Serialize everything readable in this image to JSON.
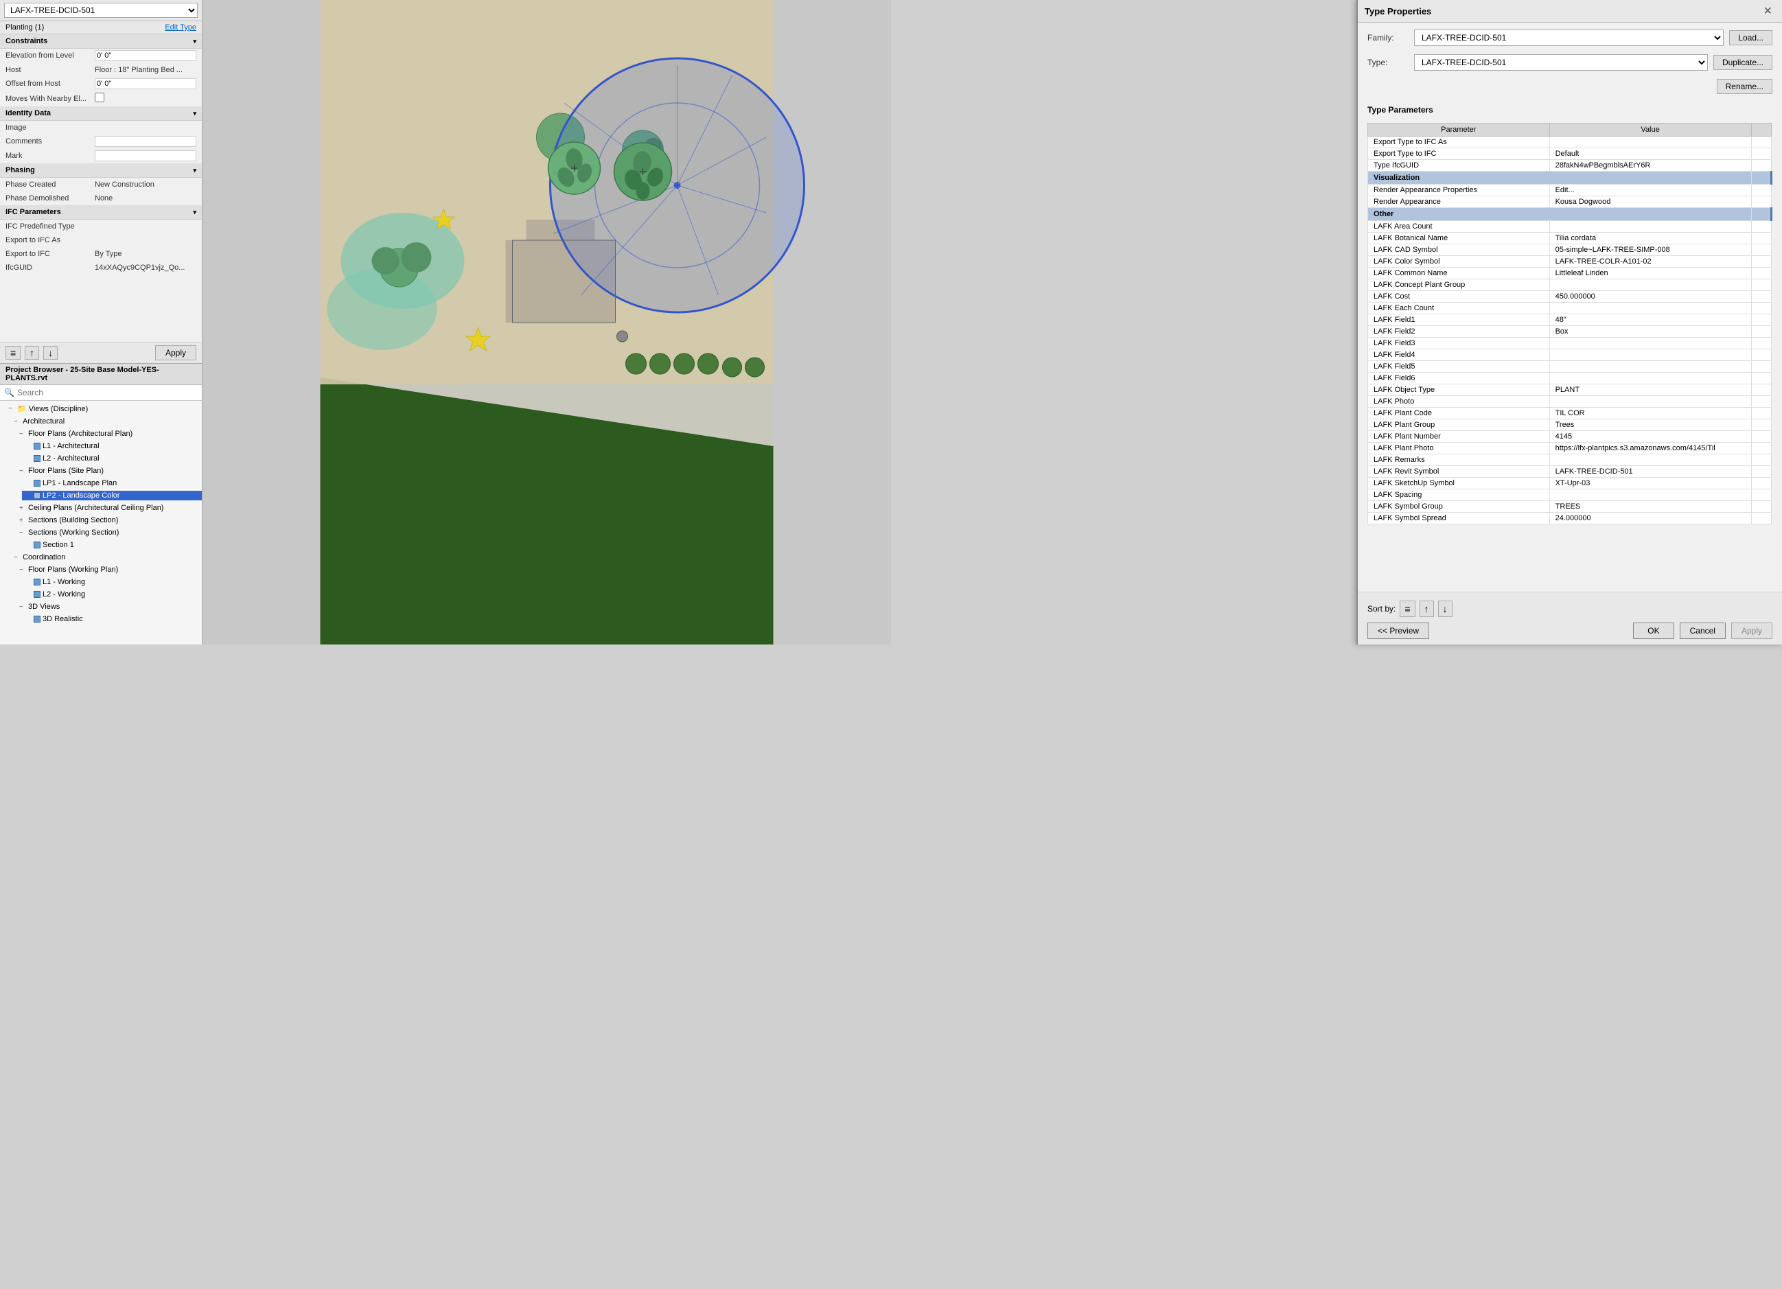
{
  "leftPanel": {
    "familyDropdown": {
      "value": "LAFXTREE-DCID-501",
      "options": [
        "LAFXTREE-DCID-501"
      ]
    },
    "editTypeLabel": "Edit Type",
    "instanceLabel": "Planting (1)",
    "sections": [
      {
        "name": "Constraints",
        "properties": [
          {
            "label": "Elevation from Level",
            "value": "0' 0\"",
            "editable": true
          },
          {
            "label": "Host",
            "value": "Floor : 18\" Planting Bed ...",
            "editable": false
          },
          {
            "label": "Offset from Host",
            "value": "0' 0\"",
            "editable": true
          },
          {
            "label": "Moves With Nearby El...",
            "value": "",
            "isCheckbox": true
          }
        ]
      },
      {
        "name": "Identity Data",
        "properties": [
          {
            "label": "Image",
            "value": "",
            "editable": false
          },
          {
            "label": "Comments",
            "value": "",
            "editable": true
          },
          {
            "label": "Mark",
            "value": "",
            "editable": true
          }
        ]
      },
      {
        "name": "Phasing",
        "properties": [
          {
            "label": "Phase Created",
            "value": "New Construction",
            "editable": false
          },
          {
            "label": "Phase Demolished",
            "value": "None",
            "editable": false
          }
        ]
      },
      {
        "name": "IFC Parameters",
        "properties": [
          {
            "label": "IFC Predefined Type",
            "value": "",
            "editable": false
          },
          {
            "label": "Export to IFC As",
            "value": "",
            "editable": false
          },
          {
            "label": "Export to IFC",
            "value": "By Type",
            "editable": false
          },
          {
            "label": "IfcGUID",
            "value": "14xXAQyc9CQP1vjz_Qo...",
            "editable": false
          }
        ]
      }
    ],
    "toolbar": {
      "icons": [
        "sort-alpha",
        "sort-category",
        "sort-custom"
      ],
      "applyLabel": "Apply"
    }
  },
  "projectBrowser": {
    "title": "Project Browser - 25-Site Base Model-YES-PLANTS.rvt",
    "searchPlaceholder": "Search",
    "tree": [
      {
        "label": "Views (Discipline)",
        "level": 0,
        "expanded": true,
        "type": "group"
      },
      {
        "label": "Architectural",
        "level": 1,
        "expanded": true,
        "type": "category"
      },
      {
        "label": "Floor Plans (Architectural Plan)",
        "level": 2,
        "expanded": true,
        "type": "subcategory"
      },
      {
        "label": "L1 - Architectural",
        "level": 3,
        "expanded": false,
        "type": "view"
      },
      {
        "label": "L2 - Architectural",
        "level": 3,
        "expanded": false,
        "type": "view"
      },
      {
        "label": "Floor Plans (Site Plan)",
        "level": 2,
        "expanded": true,
        "type": "subcategory"
      },
      {
        "label": "LP1 - Landscape Plan",
        "level": 3,
        "expanded": false,
        "type": "view"
      },
      {
        "label": "LP2 - Landscape Color",
        "level": 3,
        "expanded": false,
        "type": "view",
        "selected": true
      },
      {
        "label": "Ceiling Plans (Architectural Ceiling Plan)",
        "level": 2,
        "expanded": false,
        "type": "subcategory"
      },
      {
        "label": "Sections (Building Section)",
        "level": 2,
        "expanded": false,
        "type": "subcategory"
      },
      {
        "label": "Sections (Working Section)",
        "level": 2,
        "expanded": true,
        "type": "subcategory"
      },
      {
        "label": "Section 1",
        "level": 3,
        "expanded": false,
        "type": "view"
      },
      {
        "label": "Coordination",
        "level": 1,
        "expanded": true,
        "type": "category"
      },
      {
        "label": "Floor Plans (Working Plan)",
        "level": 2,
        "expanded": true,
        "type": "subcategory"
      },
      {
        "label": "L1 - Working",
        "level": 3,
        "expanded": false,
        "type": "view"
      },
      {
        "label": "L2 - Working",
        "level": 3,
        "expanded": false,
        "type": "view"
      },
      {
        "label": "3D Views",
        "level": 2,
        "expanded": true,
        "type": "subcategory"
      },
      {
        "label": "3D Realistic",
        "level": 3,
        "expanded": false,
        "type": "view"
      }
    ]
  },
  "typeProperties": {
    "dialogTitle": "Type Properties",
    "familyLabel": "Family:",
    "familyValue": "LAFXTREE-DCID-501",
    "typeLabel": "Type:",
    "typeValue": "LAFXTREE-DCID-501",
    "loadLabel": "Load...",
    "duplicateLabel": "Duplicate...",
    "renameLabel": "Rename...",
    "typeParametersLabel": "Type Parameters",
    "tableHeaders": [
      "Parameter",
      "Value",
      ""
    ],
    "rows": [
      {
        "type": "data",
        "param": "Export Type to IFC As",
        "value": ""
      },
      {
        "type": "data",
        "param": "Export Type to IFC",
        "value": "Default"
      },
      {
        "type": "data",
        "param": "Type IfcGUID",
        "value": "28fakN4wPBegmblsAErY6R"
      },
      {
        "type": "section",
        "param": "Visualization",
        "value": ""
      },
      {
        "type": "data",
        "param": "Render Appearance Properties",
        "value": "Edit..."
      },
      {
        "type": "data",
        "param": "Render Appearance",
        "value": "Kousa Dogwood"
      },
      {
        "type": "section",
        "param": "Other",
        "value": ""
      },
      {
        "type": "data",
        "param": "LAFK Area Count",
        "value": ""
      },
      {
        "type": "data",
        "param": "LAFK Botanical Name",
        "value": "Tilia cordata"
      },
      {
        "type": "data",
        "param": "LAFK CAD Symbol",
        "value": "05-simple~LAFK-TREE-SIMP-008"
      },
      {
        "type": "data",
        "param": "LAFK Color Symbol",
        "value": "LAFK-TREE-COLR-A101-02"
      },
      {
        "type": "data",
        "param": "LAFK Common Name",
        "value": "Littleleaf Linden"
      },
      {
        "type": "data",
        "param": "LAFK Concept Plant Group",
        "value": ""
      },
      {
        "type": "data",
        "param": "LAFK Cost",
        "value": "450.000000"
      },
      {
        "type": "data",
        "param": "LAFK Each Count",
        "value": ""
      },
      {
        "type": "data",
        "param": "LAFK Field1",
        "value": "48\""
      },
      {
        "type": "data",
        "param": "LAFK Field2",
        "value": "Box"
      },
      {
        "type": "data",
        "param": "LAFK Field3",
        "value": ""
      },
      {
        "type": "data",
        "param": "LAFK Field4",
        "value": ""
      },
      {
        "type": "data",
        "param": "LAFK Field5",
        "value": ""
      },
      {
        "type": "data",
        "param": "LAFK Field6",
        "value": ""
      },
      {
        "type": "data",
        "param": "LAFK Object Type",
        "value": "PLANT"
      },
      {
        "type": "data",
        "param": "LAFK Photo",
        "value": ""
      },
      {
        "type": "data",
        "param": "LAFK Plant Code",
        "value": "TIL COR"
      },
      {
        "type": "data",
        "param": "LAFK Plant Group",
        "value": "Trees"
      },
      {
        "type": "data",
        "param": "LAFK Plant Number",
        "value": "4145"
      },
      {
        "type": "data",
        "param": "LAFK Plant Photo",
        "value": "https://lfx-plantpics.s3.amazonaws.com/4145/Til"
      },
      {
        "type": "data",
        "param": "LAFK Remarks",
        "value": ""
      },
      {
        "type": "data",
        "param": "LAFK Revit Symbol",
        "value": "LAFK-TREE-DCID-501"
      },
      {
        "type": "data",
        "param": "LAFK SketchUp Symbol",
        "value": "XT-Upr-03"
      },
      {
        "type": "data",
        "param": "LAFK Spacing",
        "value": ""
      },
      {
        "type": "data",
        "param": "LAFK Symbol Group",
        "value": "TREES"
      },
      {
        "type": "data",
        "param": "LAFK Symbol Spread",
        "value": "24.000000"
      }
    ],
    "sortByLabel": "Sort by:",
    "previewLabel": "<< Preview",
    "okLabel": "OK",
    "cancelLabel": "Cancel",
    "applyLabel": "Apply"
  }
}
